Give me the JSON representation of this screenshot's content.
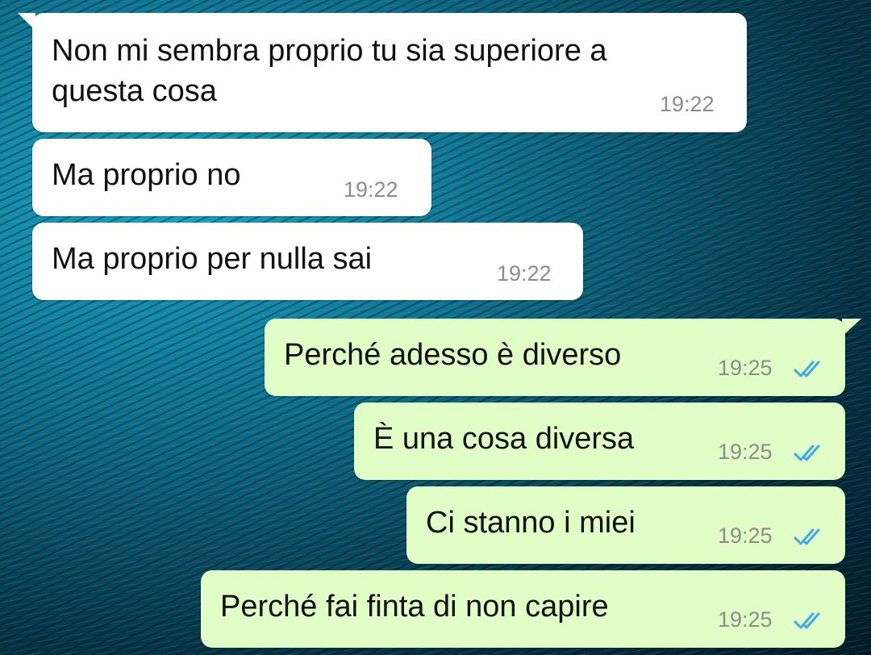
{
  "messages": [
    {
      "direction": "in",
      "text_lines": [
        "Non mi sembra proprio tu sia superiore a",
        "questa cosa"
      ],
      "time": "19:22"
    },
    {
      "direction": "in",
      "text_lines": [
        "Ma proprio no"
      ],
      "time": "19:22"
    },
    {
      "direction": "in",
      "text_lines": [
        "Ma proprio per nulla sai"
      ],
      "time": "19:22"
    },
    {
      "direction": "out",
      "text_lines": [
        "Perché adesso è diverso"
      ],
      "time": "19:25",
      "status": "read"
    },
    {
      "direction": "out",
      "text_lines": [
        "È una cosa diversa"
      ],
      "time": "19:25",
      "status": "read"
    },
    {
      "direction": "out",
      "text_lines": [
        "Ci stanno i miei"
      ],
      "time": "19:25",
      "status": "read"
    },
    {
      "direction": "out",
      "text_lines": [
        "Perché fai finta di non capire"
      ],
      "time": "19:25",
      "status": "read"
    }
  ],
  "colors": {
    "incoming_bubble": "#ffffff",
    "outgoing_bubble": "#e1fec6",
    "read_ticks": "#3fa9e8",
    "timestamp": "#8c8c8c"
  },
  "icons": {
    "read_status": "double-check-icon"
  }
}
